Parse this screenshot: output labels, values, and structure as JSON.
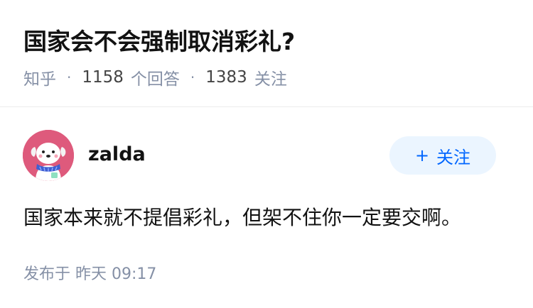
{
  "question": {
    "title": "国家会不会强制取消彩礼?",
    "source": "知乎",
    "answer_count": "1158",
    "answer_label": "个回答",
    "follower_count": "1383",
    "follower_label": "关注",
    "separator": "·"
  },
  "answer": {
    "author": {
      "name": "zalda",
      "avatar_icon": "cartoon-dog-avatar-icon",
      "avatar_bg": "#de5a7c"
    },
    "follow_button": {
      "icon": "+",
      "label": "关注"
    },
    "content": "国家本来就不提倡彩礼，但架不住你一定要交啊。",
    "time": "发布于  昨天 09:17"
  },
  "colors": {
    "accent": "#0066ff",
    "follow_bg": "#ebf5ff",
    "meta_text": "#8590a6"
  }
}
